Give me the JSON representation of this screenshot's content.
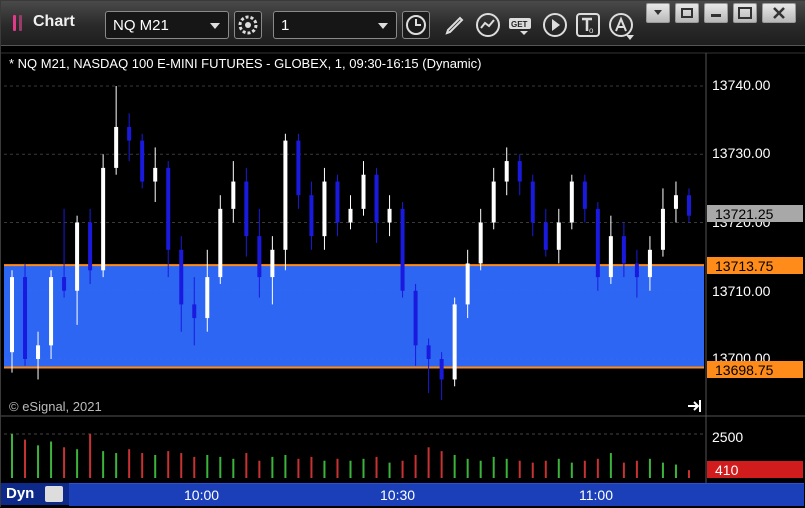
{
  "app": {
    "title": "Chart"
  },
  "toolbar": {
    "symbol": "NQ M21",
    "interval": "1",
    "icons": [
      "settings-gear-icon",
      "clock-icon",
      "pencil-icon",
      "study-icon",
      "get-icon",
      "play-icon",
      "text-tool-icon",
      "alert-icon"
    ]
  },
  "chart": {
    "header": "* NQ M21, NASDAQ 100 E-MINI FUTURES - GLOBEX, 1, 09:30-16:15 (Dynamic)",
    "copyright": "© eSignal, 2021",
    "scroll_end_icon": "scroll-to-end-icon",
    "price_labels": [
      "13740.00",
      "13730.00",
      "13720.00",
      "13710.00",
      "13700.00"
    ],
    "price_values": [
      13740,
      13730,
      13720,
      13710,
      13700
    ],
    "last_price": "13721.25",
    "zone_high": "13713.75",
    "zone_low": "13698.75",
    "volume_axis_label": "2500",
    "volume_last": "410",
    "time_labels": [
      "10:00",
      "10:30",
      "11:00"
    ],
    "footer_label": "Dyn",
    "colors": {
      "up": "#ffffff",
      "down": "#1a1adf",
      "zone_fill": "#2f6bff",
      "zone_line": "#ff8c1a",
      "axis_bg": "#1a3fb8",
      "vol_up": "#3cb43c",
      "vol_down": "#c83232"
    }
  },
  "chart_data": {
    "type": "candlestick",
    "price_range": [
      13692,
      13742
    ],
    "candles": [
      {
        "o": 13701,
        "c": 13712,
        "h": 13713,
        "l": 13698
      },
      {
        "o": 13712,
        "c": 13700,
        "h": 13714,
        "l": 13699
      },
      {
        "o": 13700,
        "c": 13702,
        "h": 13704,
        "l": 13697
      },
      {
        "o": 13702,
        "c": 13712,
        "h": 13713,
        "l": 13700
      },
      {
        "o": 13712,
        "c": 13710,
        "h": 13722,
        "l": 13709
      },
      {
        "o": 13710,
        "c": 13720,
        "h": 13721,
        "l": 13705
      },
      {
        "o": 13720,
        "c": 13713,
        "h": 13722,
        "l": 13711
      },
      {
        "o": 13713,
        "c": 13728,
        "h": 13730,
        "l": 13712
      },
      {
        "o": 13728,
        "c": 13734,
        "h": 13740,
        "l": 13727
      },
      {
        "o": 13734,
        "c": 13732,
        "h": 13736,
        "l": 13729
      },
      {
        "o": 13732,
        "c": 13726,
        "h": 13733,
        "l": 13725
      },
      {
        "o": 13726,
        "c": 13728,
        "h": 13731,
        "l": 13723
      },
      {
        "o": 13728,
        "c": 13716,
        "h": 13729,
        "l": 13712
      },
      {
        "o": 13716,
        "c": 13708,
        "h": 13718,
        "l": 13704
      },
      {
        "o": 13708,
        "c": 13706,
        "h": 13712,
        "l": 13702
      },
      {
        "o": 13706,
        "c": 13712,
        "h": 13716,
        "l": 13704
      },
      {
        "o": 13712,
        "c": 13722,
        "h": 13724,
        "l": 13711
      },
      {
        "o": 13722,
        "c": 13726,
        "h": 13729,
        "l": 13720
      },
      {
        "o": 13726,
        "c": 13718,
        "h": 13728,
        "l": 13715
      },
      {
        "o": 13718,
        "c": 13712,
        "h": 13722,
        "l": 13709
      },
      {
        "o": 13712,
        "c": 13716,
        "h": 13718,
        "l": 13708
      },
      {
        "o": 13716,
        "c": 13732,
        "h": 13733,
        "l": 13713
      },
      {
        "o": 13732,
        "c": 13724,
        "h": 13733,
        "l": 13722
      },
      {
        "o": 13724,
        "c": 13718,
        "h": 13726,
        "l": 13716
      },
      {
        "o": 13718,
        "c": 13726,
        "h": 13728,
        "l": 13716
      },
      {
        "o": 13726,
        "c": 13720,
        "h": 13727,
        "l": 13718
      },
      {
        "o": 13720,
        "c": 13722,
        "h": 13724,
        "l": 13719
      },
      {
        "o": 13722,
        "c": 13727,
        "h": 13729,
        "l": 13721
      },
      {
        "o": 13727,
        "c": 13720,
        "h": 13728,
        "l": 13717
      },
      {
        "o": 13720,
        "c": 13722,
        "h": 13724,
        "l": 13718
      },
      {
        "o": 13722,
        "c": 13710,
        "h": 13723,
        "l": 13709
      },
      {
        "o": 13710,
        "c": 13702,
        "h": 13711,
        "l": 13699
      },
      {
        "o": 13702,
        "c": 13700,
        "h": 13703,
        "l": 13695
      },
      {
        "o": 13700,
        "c": 13697,
        "h": 13701,
        "l": 13694
      },
      {
        "o": 13697,
        "c": 13708,
        "h": 13709,
        "l": 13696
      },
      {
        "o": 13708,
        "c": 13714,
        "h": 13716,
        "l": 13706
      },
      {
        "o": 13714,
        "c": 13720,
        "h": 13722,
        "l": 13713
      },
      {
        "o": 13720,
        "c": 13726,
        "h": 13728,
        "l": 13719
      },
      {
        "o": 13726,
        "c": 13729,
        "h": 13731,
        "l": 13724
      },
      {
        "o": 13729,
        "c": 13726,
        "h": 13730,
        "l": 13724
      },
      {
        "o": 13726,
        "c": 13720,
        "h": 13727,
        "l": 13718
      },
      {
        "o": 13720,
        "c": 13716,
        "h": 13722,
        "l": 13715
      },
      {
        "o": 13716,
        "c": 13720,
        "h": 13722,
        "l": 13714
      },
      {
        "o": 13720,
        "c": 13726,
        "h": 13727,
        "l": 13719
      },
      {
        "o": 13726,
        "c": 13722,
        "h": 13727,
        "l": 13720
      },
      {
        "o": 13722,
        "c": 13712,
        "h": 13723,
        "l": 13710
      },
      {
        "o": 13712,
        "c": 13718,
        "h": 13721,
        "l": 13711
      },
      {
        "o": 13718,
        "c": 13714,
        "h": 13720,
        "l": 13712
      },
      {
        "o": 13714,
        "c": 13712,
        "h": 13716,
        "l": 13709
      },
      {
        "o": 13712,
        "c": 13716,
        "h": 13718,
        "l": 13710
      },
      {
        "o": 13716,
        "c": 13722,
        "h": 13725,
        "l": 13715
      },
      {
        "o": 13722,
        "c": 13724,
        "h": 13726,
        "l": 13720
      },
      {
        "o": 13724,
        "c": 13721,
        "h": 13725,
        "l": 13720
      }
    ],
    "volume": [
      2300,
      2000,
      1700,
      1900,
      1600,
      1500,
      2300,
      1400,
      1300,
      1500,
      1300,
      1200,
      1400,
      1300,
      1100,
      1200,
      1100,
      1000,
      1300,
      900,
      1100,
      1200,
      1000,
      1100,
      900,
      1000,
      900,
      1000,
      1100,
      800,
      900,
      1200,
      1600,
      1400,
      1200,
      1000,
      900,
      1100,
      1000,
      900,
      800,
      900,
      1000,
      800,
      900,
      1000,
      1300,
      800,
      900,
      1000,
      800,
      700,
      410
    ]
  }
}
